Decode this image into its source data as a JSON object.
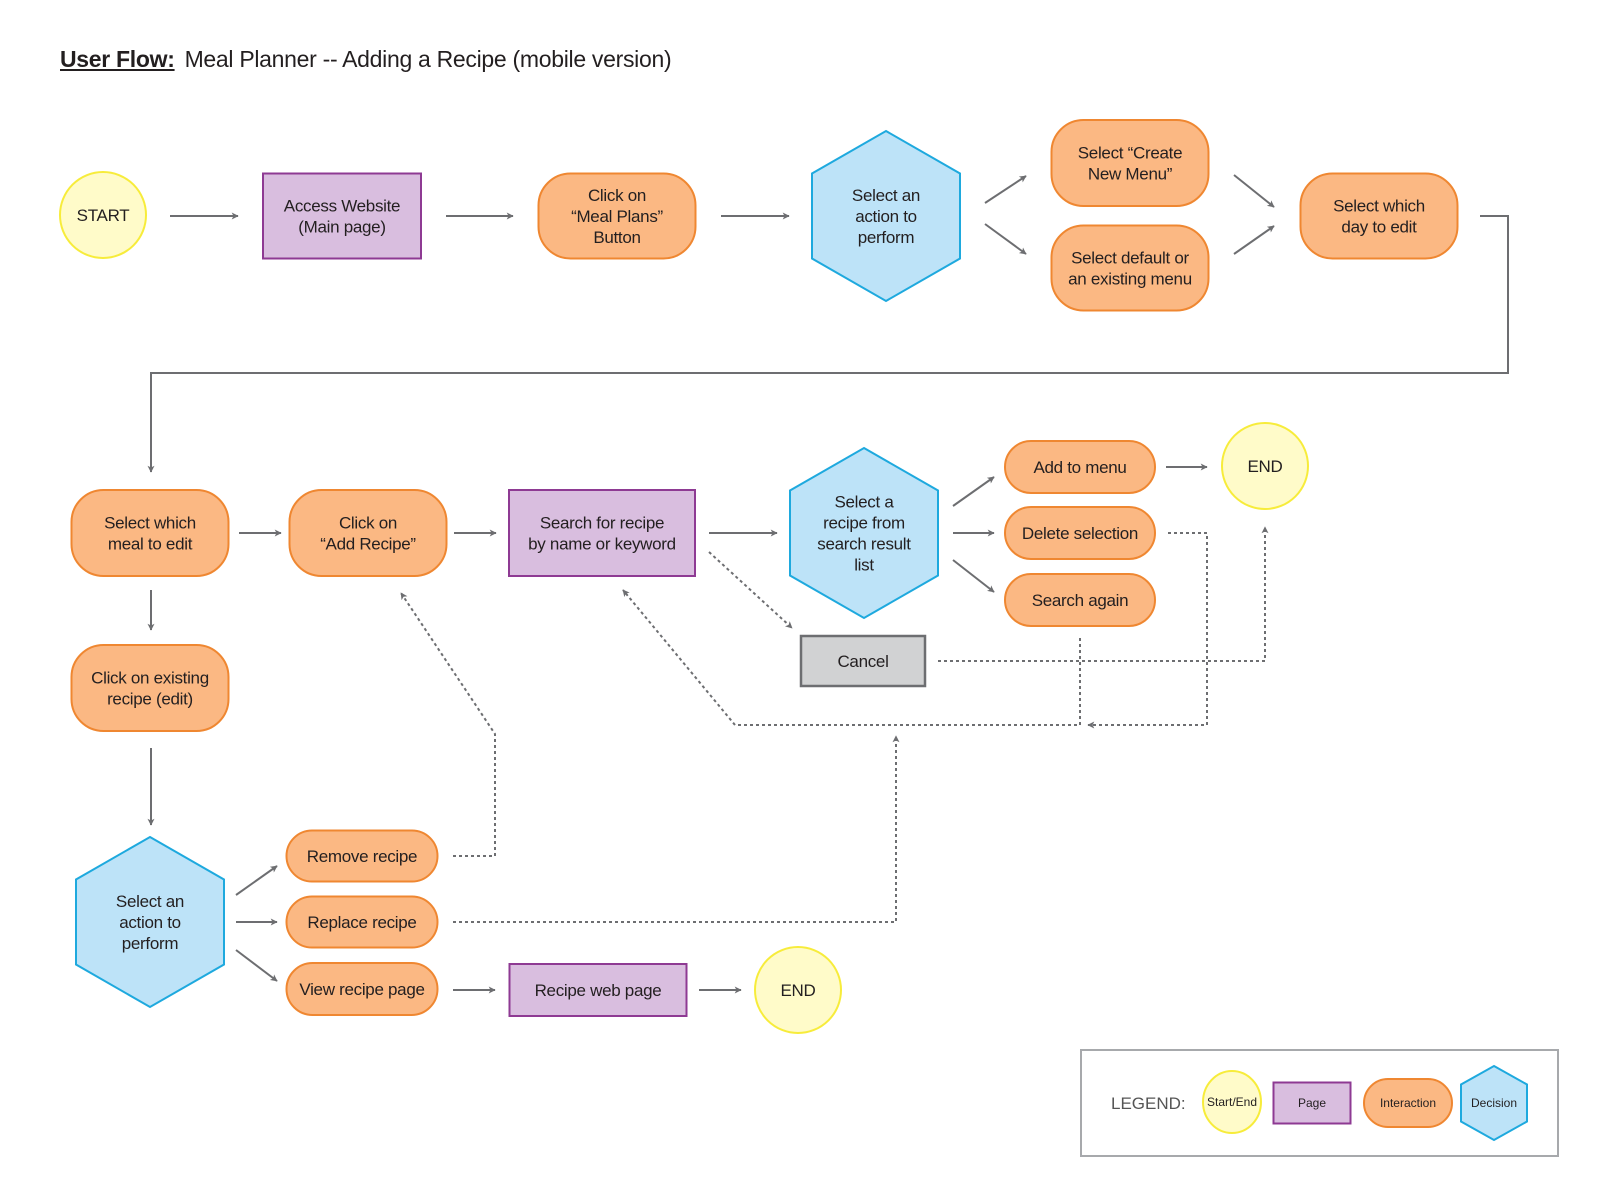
{
  "title": {
    "lead": "User Flow:",
    "text": "Meal Planner -- Adding a Recipe (mobile version)"
  },
  "colors": {
    "start_end_fill": "#FFFBC9",
    "start_end_stroke": "#F7EC3B",
    "page_fill": "#D9BEDF",
    "page_stroke": "#8E3A93",
    "interaction_fill": "#FBB883",
    "interaction_stroke": "#EF8731",
    "decision_fill": "#BDE3F8",
    "decision_stroke": "#1EA9DE",
    "cancel_fill": "#D1D2D3",
    "cancel_stroke": "#6D6E71",
    "connector": "#6D6E71"
  },
  "nodes": {
    "start": {
      "type": "start_end",
      "lines": [
        "START"
      ]
    },
    "access_website": {
      "type": "page",
      "lines": [
        "Access Website",
        "(Main page)"
      ]
    },
    "meal_plans": {
      "type": "interaction",
      "lines": [
        "Click on",
        "“Meal Plans”",
        "Button"
      ]
    },
    "action1": {
      "type": "decision",
      "lines": [
        "Select an",
        "action to",
        "perform"
      ]
    },
    "create_menu": {
      "type": "interaction",
      "lines": [
        "Select “Create",
        "New Menu”"
      ]
    },
    "existing_menu": {
      "type": "interaction",
      "lines": [
        "Select default or",
        "an existing menu"
      ]
    },
    "day_edit": {
      "type": "interaction",
      "lines": [
        "Select which",
        "day to edit"
      ]
    },
    "meal_edit": {
      "type": "interaction",
      "lines": [
        "Select which",
        "meal to edit"
      ]
    },
    "add_recipe": {
      "type": "interaction",
      "lines": [
        "Click on",
        "“Add Recipe”"
      ]
    },
    "search_recipe": {
      "type": "page",
      "lines": [
        "Search for recipe",
        "by name or keyword"
      ]
    },
    "select_recipe": {
      "type": "decision",
      "lines": [
        "Select a",
        "recipe from",
        "search result",
        "list"
      ]
    },
    "add_to_menu": {
      "type": "interaction",
      "lines": [
        "Add to menu"
      ]
    },
    "delete_selection": {
      "type": "interaction",
      "lines": [
        "Delete selection"
      ]
    },
    "search_again": {
      "type": "interaction",
      "lines": [
        "Search again"
      ]
    },
    "end1": {
      "type": "start_end",
      "lines": [
        "END"
      ]
    },
    "cancel": {
      "type": "cancel",
      "lines": [
        "Cancel"
      ]
    },
    "existing_recipe": {
      "type": "interaction",
      "lines": [
        "Click on existing",
        "recipe (edit)"
      ]
    },
    "action2": {
      "type": "decision",
      "lines": [
        "Select an",
        "action to",
        "perform"
      ]
    },
    "remove_recipe": {
      "type": "interaction",
      "lines": [
        "Remove recipe"
      ]
    },
    "replace_recipe": {
      "type": "interaction",
      "lines": [
        "Replace recipe"
      ]
    },
    "view_recipe": {
      "type": "interaction",
      "lines": [
        "View recipe page"
      ]
    },
    "recipe_web_page": {
      "type": "page",
      "lines": [
        "Recipe web page"
      ]
    },
    "end2": {
      "type": "start_end",
      "lines": [
        "END"
      ]
    }
  },
  "edges": [
    {
      "from": "start",
      "to": "access_website",
      "style": "solid"
    },
    {
      "from": "access_website",
      "to": "meal_plans",
      "style": "solid"
    },
    {
      "from": "meal_plans",
      "to": "action1",
      "style": "solid"
    },
    {
      "from": "action1",
      "to": "create_menu",
      "style": "solid"
    },
    {
      "from": "action1",
      "to": "existing_menu",
      "style": "solid"
    },
    {
      "from": "create_menu",
      "to": "day_edit",
      "style": "solid"
    },
    {
      "from": "existing_menu",
      "to": "day_edit",
      "style": "solid"
    },
    {
      "from": "day_edit",
      "to": "meal_edit",
      "style": "solid"
    },
    {
      "from": "meal_edit",
      "to": "add_recipe",
      "style": "solid"
    },
    {
      "from": "add_recipe",
      "to": "search_recipe",
      "style": "solid"
    },
    {
      "from": "search_recipe",
      "to": "select_recipe",
      "style": "solid"
    },
    {
      "from": "search_recipe",
      "to": "cancel",
      "style": "dotted"
    },
    {
      "from": "select_recipe",
      "to": "add_to_menu",
      "style": "solid"
    },
    {
      "from": "select_recipe",
      "to": "delete_selection",
      "style": "solid"
    },
    {
      "from": "select_recipe",
      "to": "search_again",
      "style": "solid"
    },
    {
      "from": "add_to_menu",
      "to": "end1",
      "style": "solid"
    },
    {
      "from": "cancel",
      "to": "end1",
      "style": "dotted"
    },
    {
      "from": "delete_selection",
      "to": "search_recipe",
      "style": "dotted"
    },
    {
      "from": "search_again",
      "to": "search_recipe",
      "style": "dotted"
    },
    {
      "from": "meal_edit",
      "to": "existing_recipe",
      "style": "solid"
    },
    {
      "from": "existing_recipe",
      "to": "action2",
      "style": "solid"
    },
    {
      "from": "action2",
      "to": "remove_recipe",
      "style": "solid"
    },
    {
      "from": "action2",
      "to": "replace_recipe",
      "style": "solid"
    },
    {
      "from": "action2",
      "to": "view_recipe",
      "style": "solid"
    },
    {
      "from": "remove_recipe",
      "to": "add_recipe",
      "style": "dotted"
    },
    {
      "from": "replace_recipe",
      "to": "search_recipe",
      "style": "dotted"
    },
    {
      "from": "view_recipe",
      "to": "recipe_web_page",
      "style": "solid"
    },
    {
      "from": "recipe_web_page",
      "to": "end2",
      "style": "solid"
    }
  ],
  "legend": {
    "label": "LEGEND:",
    "items": [
      {
        "type": "start_end",
        "label": "Start/End"
      },
      {
        "type": "page",
        "label": "Page"
      },
      {
        "type": "interaction",
        "label": "Interaction"
      },
      {
        "type": "decision",
        "label": "Decision"
      }
    ]
  }
}
